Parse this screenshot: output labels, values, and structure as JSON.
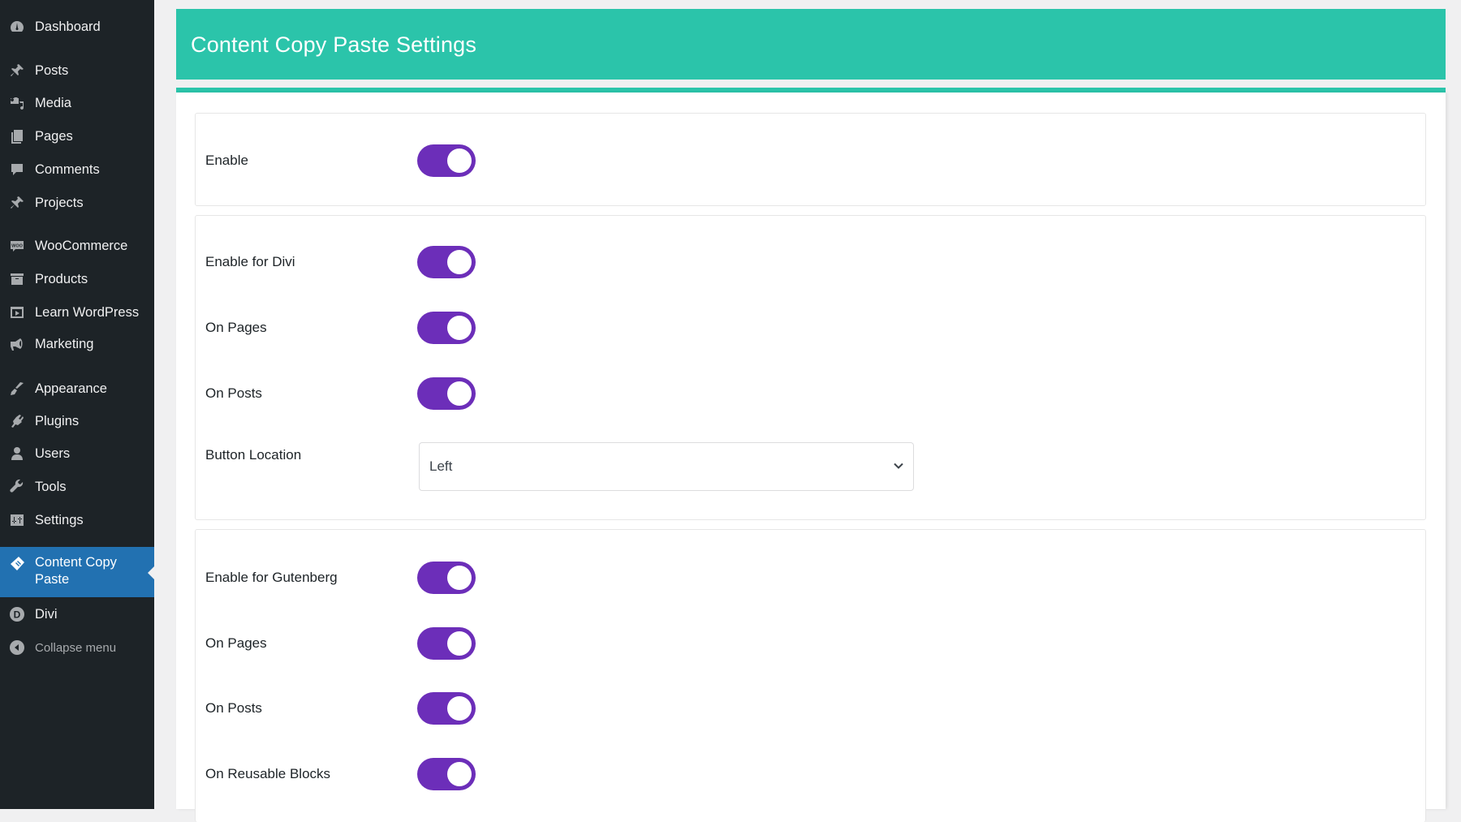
{
  "sidebar": {
    "items": [
      {
        "label": "Dashboard",
        "icon": "dashboard-icon"
      },
      {
        "label": "Posts",
        "icon": "pushpin-icon"
      },
      {
        "label": "Media",
        "icon": "media-icon"
      },
      {
        "label": "Pages",
        "icon": "pages-icon"
      },
      {
        "label": "Comments",
        "icon": "comment-icon"
      },
      {
        "label": "Projects",
        "icon": "pushpin-icon"
      },
      {
        "label": "WooCommerce",
        "icon": "woo-icon"
      },
      {
        "label": "Products",
        "icon": "archive-box-icon"
      },
      {
        "label": "Learn WordPress",
        "icon": "video-icon"
      },
      {
        "label": "Marketing",
        "icon": "megaphone-icon"
      },
      {
        "label": "Appearance",
        "icon": "paintbrush-icon"
      },
      {
        "label": "Plugins",
        "icon": "plug-icon"
      },
      {
        "label": "Users",
        "icon": "user-icon"
      },
      {
        "label": "Tools",
        "icon": "wrench-icon"
      },
      {
        "label": "Settings",
        "icon": "sliders-icon"
      },
      {
        "label": "Content Copy Paste",
        "icon": "clipboard-tag-icon",
        "active": true
      },
      {
        "label": "Divi",
        "icon": "divi-logo-icon"
      },
      {
        "label": "Collapse menu",
        "icon": "collapse-arrow-icon"
      }
    ]
  },
  "header": {
    "title": "Content Copy Paste Settings"
  },
  "colors": {
    "header": "#2bc4aa",
    "toggle_on": "#6c2eb9",
    "sidebar": "#1d2327",
    "sidebar_active": "#2271b1"
  },
  "settings": {
    "general": {
      "enable": {
        "label": "Enable",
        "on": true
      }
    },
    "divi": {
      "enable": {
        "label": "Enable for Divi",
        "on": true
      },
      "pages": {
        "label": "On Pages",
        "on": true
      },
      "posts": {
        "label": "On Posts",
        "on": true
      },
      "button_location": {
        "label": "Button Location",
        "value": "Left"
      }
    },
    "gutenberg": {
      "enable": {
        "label": "Enable for Gutenberg",
        "on": true
      },
      "pages": {
        "label": "On Pages",
        "on": true
      },
      "posts": {
        "label": "On Posts",
        "on": true
      },
      "reusable": {
        "label": "On Reusable Blocks",
        "on": true
      }
    }
  }
}
